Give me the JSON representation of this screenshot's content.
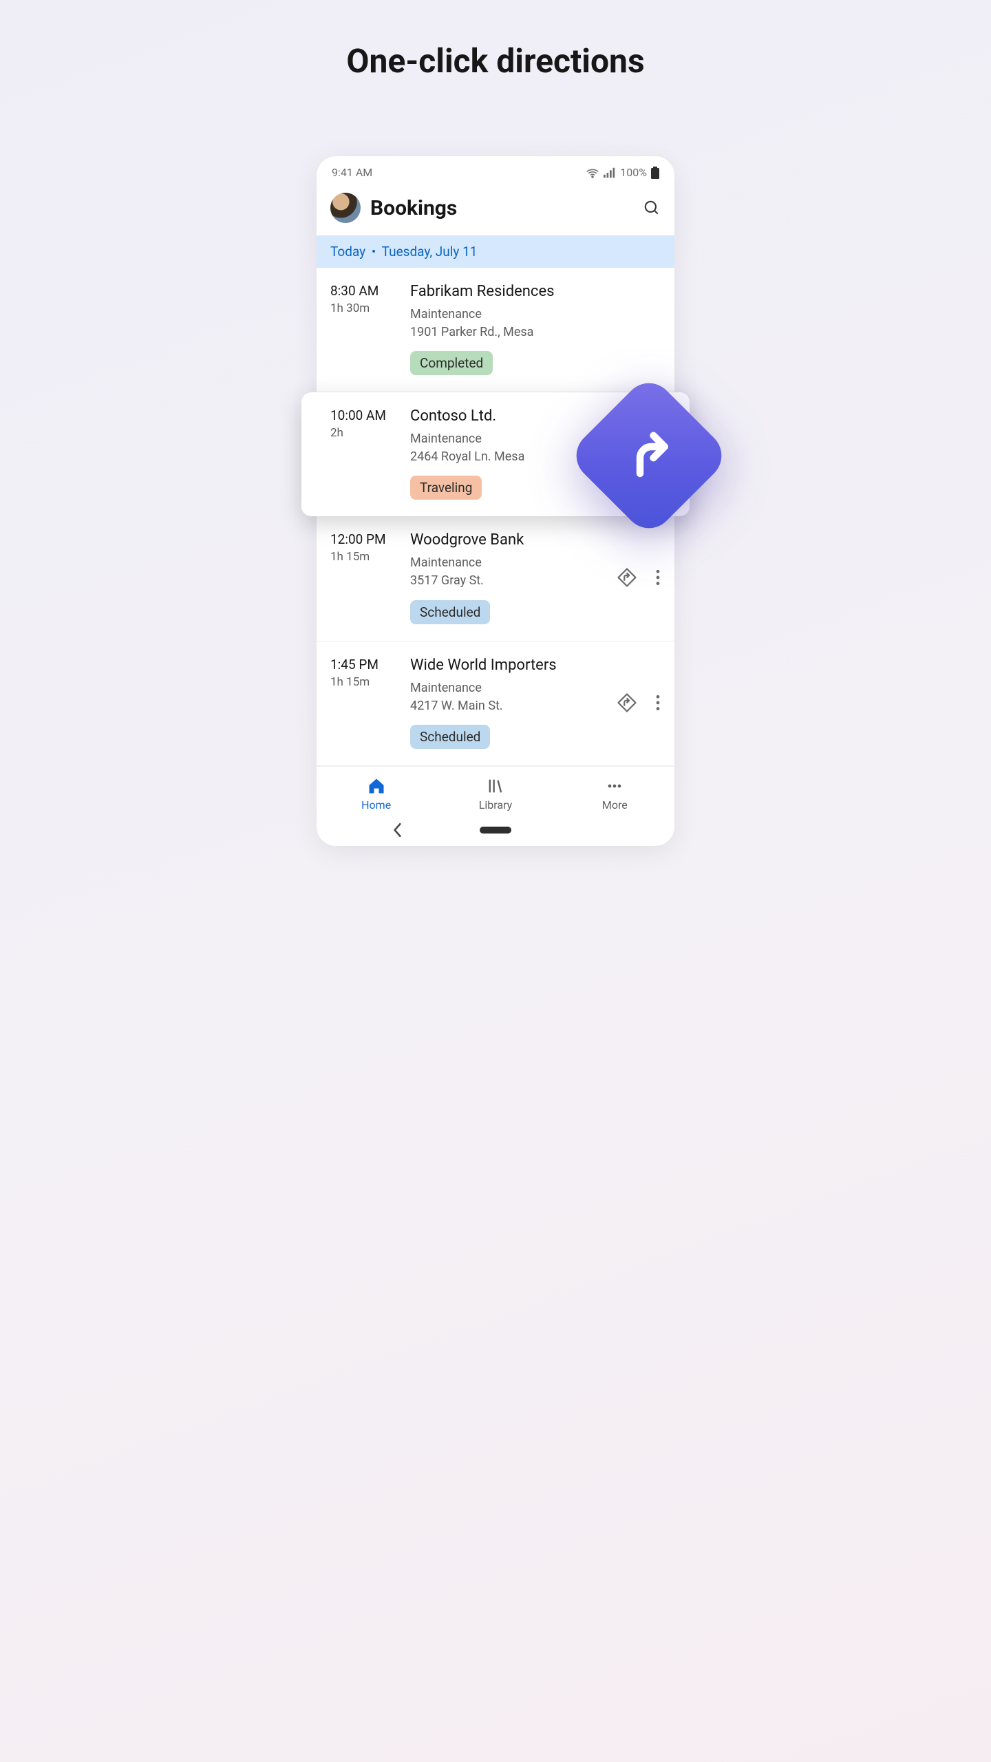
{
  "headline": "One-click directions",
  "statusbar": {
    "time": "9:41 AM",
    "battery": "100%"
  },
  "header": {
    "title": "Bookings"
  },
  "date_banner": {
    "prefix": "Today",
    "dot": "•",
    "date": "Tuesday, July 11"
  },
  "bookings": [
    {
      "start": "8:30 AM",
      "duration": "1h 30m",
      "title": "Fabrikam Residences",
      "service": "Maintenance",
      "address": "1901 Parker Rd., Mesa",
      "status": "Completed",
      "status_class": "status-completed",
      "show_actions": false,
      "elevated": false
    },
    {
      "start": "10:00 AM",
      "duration": "2h",
      "title": "Contoso Ltd.",
      "service": "Maintenance",
      "address": "2464 Royal Ln. Mesa",
      "status": "Traveling",
      "status_class": "status-traveling",
      "show_actions": true,
      "elevated": true
    },
    {
      "start": "12:00 PM",
      "duration": "1h 15m",
      "title": "Woodgrove Bank",
      "service": "Maintenance",
      "address": "3517 Gray St.",
      "status": "Scheduled",
      "status_class": "status-scheduled",
      "show_actions": true,
      "elevated": false
    },
    {
      "start": "1:45 PM",
      "duration": "1h 15m",
      "title": "Wide World Importers",
      "service": "Maintenance",
      "address": "4217 W. Main St.",
      "status": "Scheduled",
      "status_class": "status-scheduled",
      "show_actions": true,
      "elevated": false
    }
  ],
  "nav": {
    "home": "Home",
    "library": "Library",
    "more": "More"
  }
}
